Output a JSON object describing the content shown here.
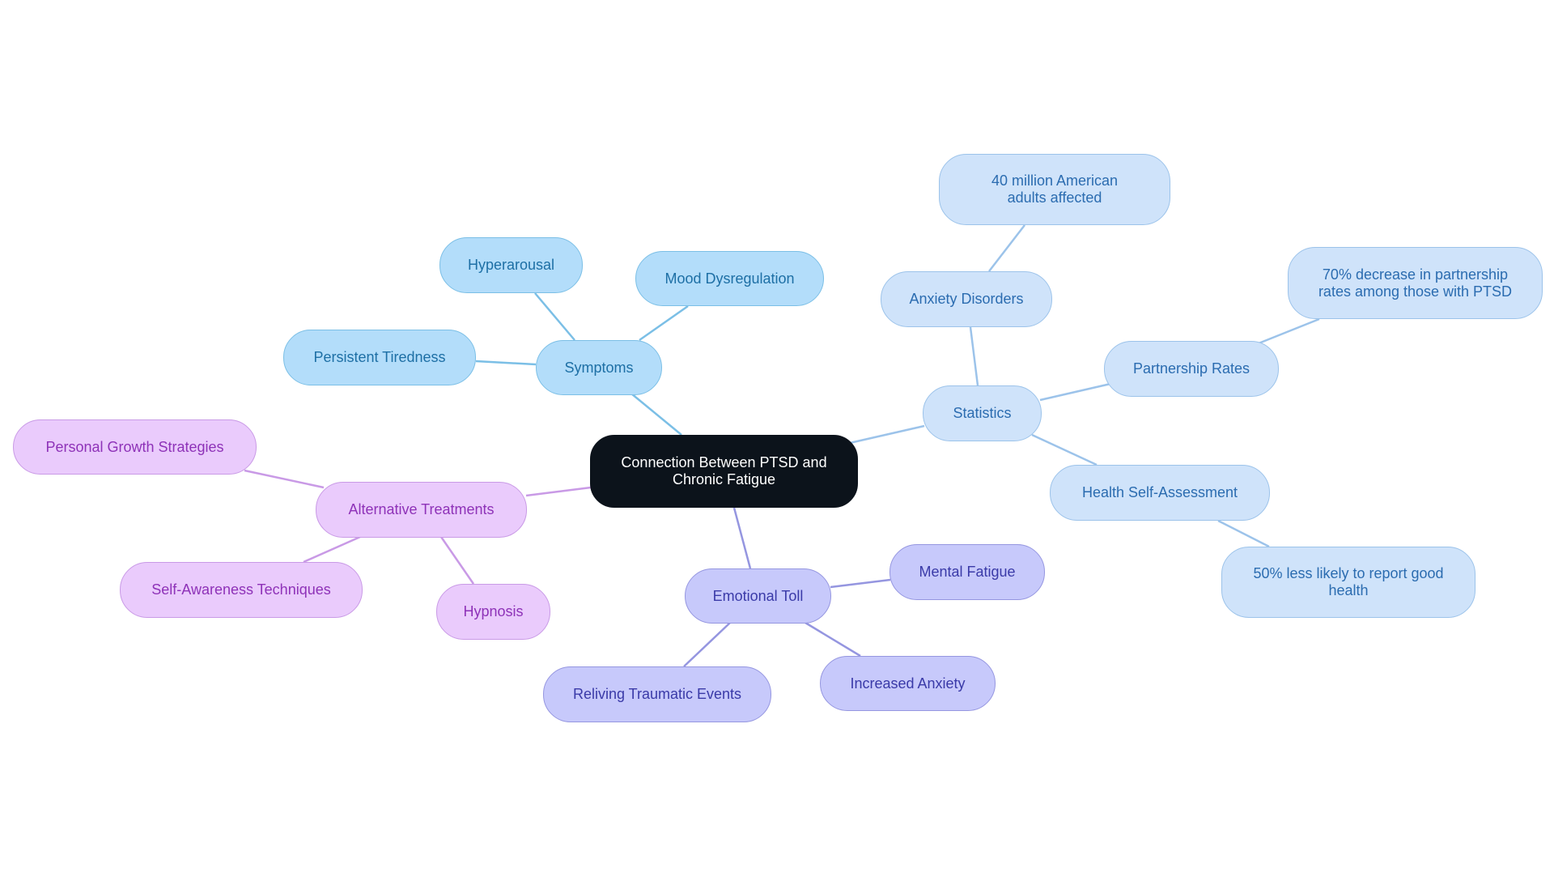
{
  "diagram": {
    "type": "mindmap",
    "root": {
      "id": "root",
      "label": "Connection Between PTSD and Chronic Fatigue"
    },
    "branch_colors": {
      "symptoms": {
        "fill": "#b3ddfa",
        "stroke": "#7bbfe6",
        "text": "#1d6fa5"
      },
      "statistics": {
        "fill": "#cfe3fa",
        "stroke": "#9cc3ea",
        "text": "#2b6cb0"
      },
      "emotional": {
        "fill": "#c7c9fb",
        "stroke": "#9596e0",
        "text": "#3a3aa8"
      },
      "alternative": {
        "fill": "#eacbfc",
        "stroke": "#c99ae6",
        "text": "#8e32b8"
      },
      "root": {
        "fill": "#0c131b",
        "text": "#ffffff"
      }
    },
    "nodes": {
      "symptoms": "Symptoms",
      "hyperarousal": "Hyperarousal",
      "mood": "Mood Dysregulation",
      "tiredness": "Persistent Tiredness",
      "statistics": "Statistics",
      "anxiety_disorders": "Anxiety Disorders",
      "forty_million": "40 million American adults affected",
      "partnership": "Partnership Rates",
      "seventy": "70% decrease in partnership rates among those with PTSD",
      "health": "Health Self-Assessment",
      "fifty": "50% less likely to report good health",
      "alternative": "Alternative Treatments",
      "personal_growth": "Personal Growth Strategies",
      "self_awareness": "Self-Awareness Techniques",
      "hypnosis": "Hypnosis",
      "emotional": "Emotional Toll",
      "mental_fatigue": "Mental Fatigue",
      "increased_anxiety": "Increased Anxiety",
      "reliving": "Reliving Traumatic Events"
    },
    "edges": [
      [
        "root",
        "symptoms"
      ],
      [
        "symptoms",
        "hyperarousal"
      ],
      [
        "symptoms",
        "mood"
      ],
      [
        "symptoms",
        "tiredness"
      ],
      [
        "root",
        "statistics"
      ],
      [
        "statistics",
        "anxiety_disorders"
      ],
      [
        "anxiety_disorders",
        "forty_million"
      ],
      [
        "statistics",
        "partnership"
      ],
      [
        "partnership",
        "seventy"
      ],
      [
        "statistics",
        "health"
      ],
      [
        "health",
        "fifty"
      ],
      [
        "root",
        "alternative"
      ],
      [
        "alternative",
        "personal_growth"
      ],
      [
        "alternative",
        "self_awareness"
      ],
      [
        "alternative",
        "hypnosis"
      ],
      [
        "root",
        "emotional"
      ],
      [
        "emotional",
        "mental_fatigue"
      ],
      [
        "emotional",
        "increased_anxiety"
      ],
      [
        "emotional",
        "reliving"
      ]
    ]
  }
}
